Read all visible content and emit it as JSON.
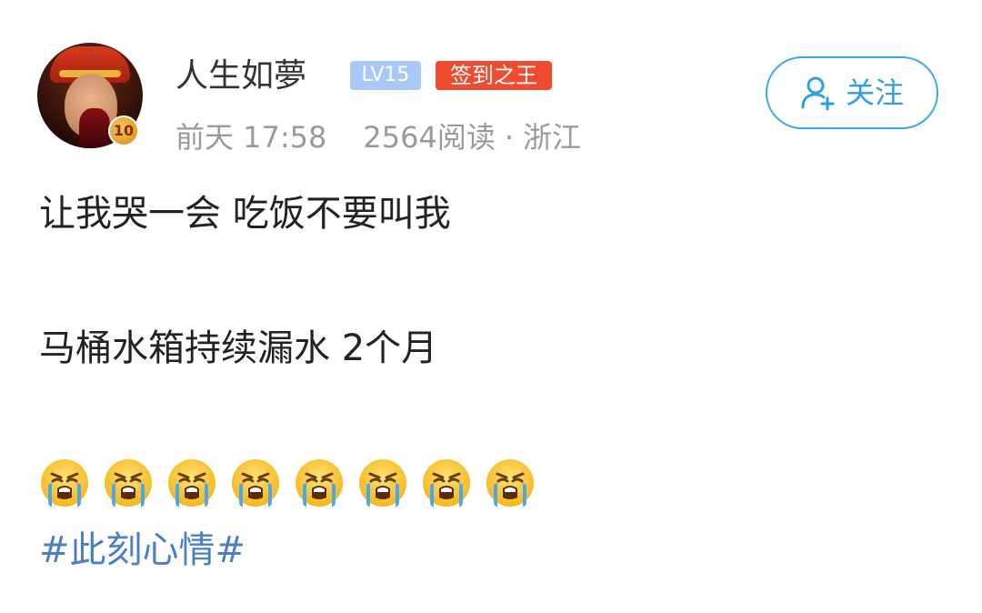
{
  "user": {
    "name": "人生如夢",
    "level": "LV15",
    "title_badge": "签到之王",
    "rank_number": "10"
  },
  "meta": {
    "time": "前天 17:58",
    "reads": "2564阅读",
    "separator": "·",
    "location": "浙江"
  },
  "follow_button": {
    "label": "关注",
    "icon": "add-user-icon",
    "color": "#2f9ee3"
  },
  "post": {
    "line1": "让我哭一会 吃饭不要叫我",
    "line2": "马桶水箱持续漏水 2个月",
    "emoji": [
      "loudly-crying-face",
      "loudly-crying-face",
      "loudly-crying-face",
      "loudly-crying-face",
      "loudly-crying-face",
      "loudly-crying-face",
      "loudly-crying-face",
      "loudly-crying-face"
    ],
    "hashtag": "#此刻心情#"
  },
  "colors": {
    "hashtag": "#4a7fc4",
    "level_badge": "#a8c9f7",
    "title_badge": "#f04a2f",
    "meta_text": "#9a9a9a"
  }
}
